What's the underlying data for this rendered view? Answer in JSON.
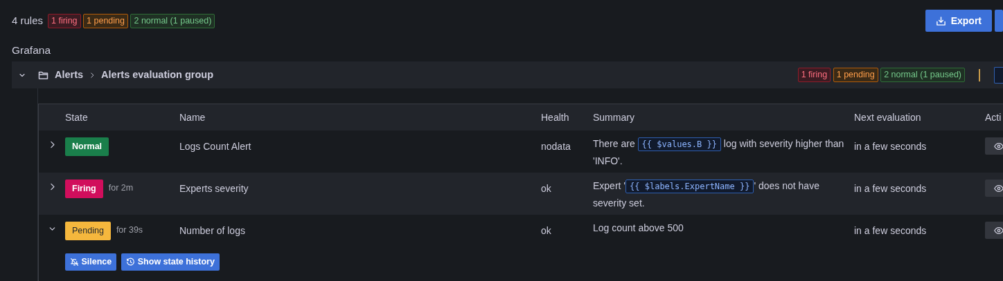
{
  "summary": {
    "total": "4 rules",
    "badges": [
      {
        "kind": "firing",
        "text": "1 firing"
      },
      {
        "kind": "pending",
        "text": "1 pending"
      },
      {
        "kind": "normal",
        "text": "2 normal (1 paused)"
      }
    ]
  },
  "export_button": "Export",
  "namespace": "Grafana",
  "group": {
    "expanded": true,
    "folder": "Alerts",
    "name": "Alerts evaluation group",
    "badges": [
      {
        "kind": "firing",
        "text": "1 firing"
      },
      {
        "kind": "pending",
        "text": "1 pending"
      },
      {
        "kind": "normal",
        "text": "2 normal (1 paused)"
      }
    ]
  },
  "table": {
    "columns": [
      "State",
      "Name",
      "Health",
      "Summary",
      "Next evaluation",
      "Acti"
    ],
    "rows": [
      {
        "expanded": false,
        "state": "Normal",
        "color": "#1a7f4b",
        "name": "Logs Count Alert",
        "health": "nodata",
        "summary": [
          {
            "kind": "text",
            "text": "There are "
          },
          {
            "kind": "code",
            "text": "{{ $values.B }}"
          },
          {
            "kind": "text",
            "text": " log with severity higher than 'INFO'."
          }
        ],
        "next_evaluation": "in a few seconds"
      },
      {
        "expanded": false,
        "state": "Firing",
        "color": "#d10e5c",
        "duration": "for 2m",
        "name": "Experts severity",
        "health": "ok",
        "summary": [
          {
            "kind": "text",
            "text": "Expert '"
          },
          {
            "kind": "code",
            "text": "{{ $labels.ExpertName }}"
          },
          {
            "kind": "text",
            "text": "' does not have severity set."
          }
        ],
        "next_evaluation": "in a few seconds"
      },
      {
        "expanded": true,
        "state": "Pending",
        "color": "#f5b73d",
        "duration": "for 39s",
        "name": "Number of logs",
        "health": "ok",
        "summary": [
          {
            "kind": "text",
            "text": "Log count above 500"
          }
        ],
        "next_evaluation": "in a few seconds",
        "actions": [
          {
            "kind": "silence",
            "label": "Silence"
          },
          {
            "kind": "history",
            "label": "Show state history"
          }
        ]
      }
    ]
  }
}
